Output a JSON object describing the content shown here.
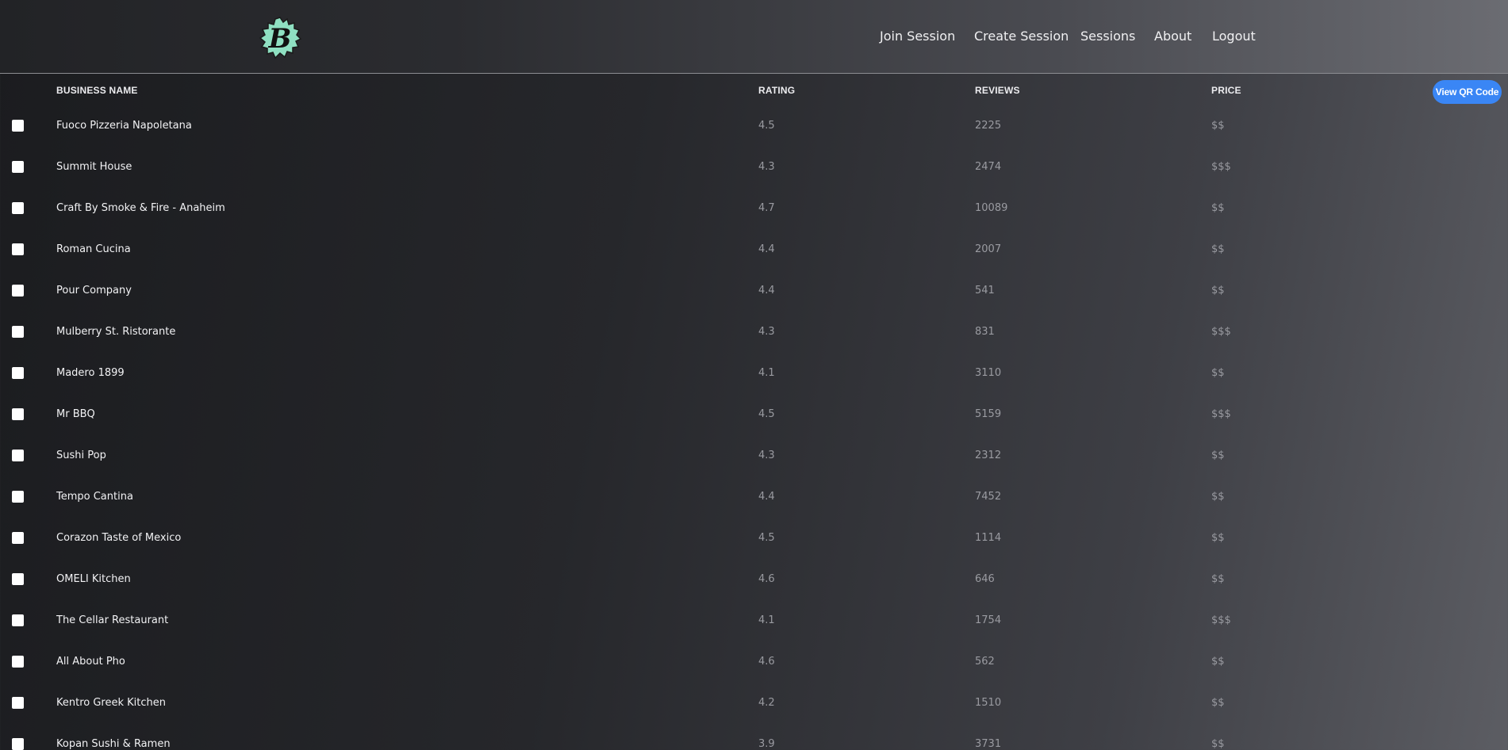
{
  "header": {
    "logo_letter": "B",
    "nav": [
      {
        "label": "Join Session"
      },
      {
        "label": "Create Session"
      },
      {
        "label": "Sessions"
      },
      {
        "label": "About"
      },
      {
        "label": "Logout"
      }
    ]
  },
  "table": {
    "columns": {
      "name": "BUSINESS NAME",
      "rating": "RATING",
      "reviews": "REVIEWS",
      "price": "PRICE"
    },
    "qr_button_label": "View QR Code",
    "rows": [
      {
        "name": "Fuoco Pizzeria Napoletana",
        "rating": "4.5",
        "reviews": "2225",
        "price": "$$"
      },
      {
        "name": "Summit House",
        "rating": "4.3",
        "reviews": "2474",
        "price": "$$$"
      },
      {
        "name": "Craft By Smoke & Fire - Anaheim",
        "rating": "4.7",
        "reviews": "10089",
        "price": "$$"
      },
      {
        "name": "Roman Cucina",
        "rating": "4.4",
        "reviews": "2007",
        "price": "$$"
      },
      {
        "name": "Pour Company",
        "rating": "4.4",
        "reviews": "541",
        "price": "$$"
      },
      {
        "name": "Mulberry St. Ristorante",
        "rating": "4.3",
        "reviews": "831",
        "price": "$$$"
      },
      {
        "name": "Madero 1899",
        "rating": "4.1",
        "reviews": "3110",
        "price": "$$"
      },
      {
        "name": "Mr BBQ",
        "rating": "4.5",
        "reviews": "5159",
        "price": "$$$"
      },
      {
        "name": "Sushi Pop",
        "rating": "4.3",
        "reviews": "2312",
        "price": "$$"
      },
      {
        "name": "Tempo Cantina",
        "rating": "4.4",
        "reviews": "7452",
        "price": "$$"
      },
      {
        "name": "Corazon Taste of Mexico",
        "rating": "4.5",
        "reviews": "1114",
        "price": "$$"
      },
      {
        "name": "OMELI Kitchen",
        "rating": "4.6",
        "reviews": "646",
        "price": "$$"
      },
      {
        "name": "The Cellar Restaurant",
        "rating": "4.1",
        "reviews": "1754",
        "price": "$$$"
      },
      {
        "name": "All About Pho",
        "rating": "4.6",
        "reviews": "562",
        "price": "$$"
      },
      {
        "name": "Kentro Greek Kitchen",
        "rating": "4.2",
        "reviews": "1510",
        "price": "$$"
      },
      {
        "name": "Kopan Sushi & Ramen",
        "rating": "3.9",
        "reviews": "3731",
        "price": "$$"
      }
    ]
  }
}
